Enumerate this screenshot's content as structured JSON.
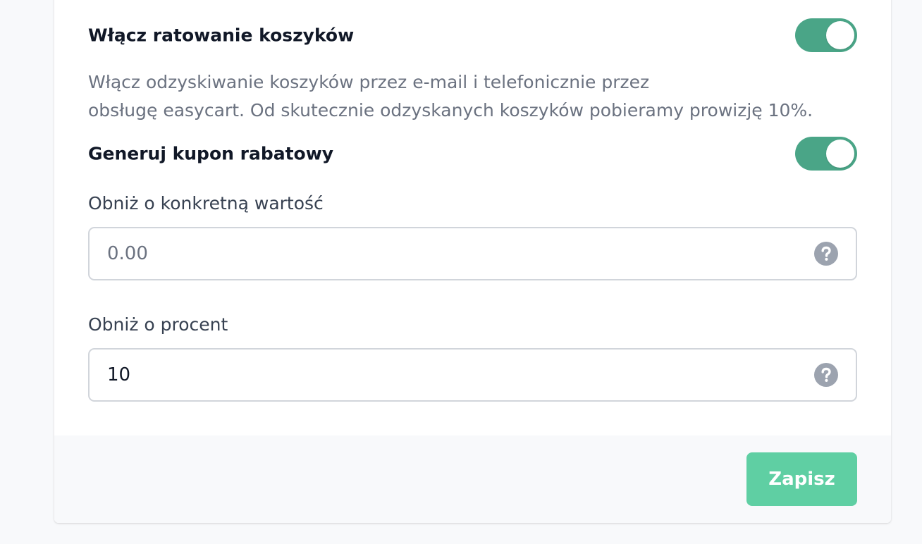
{
  "cart_recovery": {
    "title": "Włącz ratowanie koszyków",
    "enabled": true,
    "description_line1": "Włącz odzyskiwanie koszyków przez e-mail i telefonicznie przez",
    "description_line2": "obsługę easycart. Od skutecznie odzyskanych koszyków pobieramy prowizję 10%."
  },
  "coupon": {
    "title": "Generuj kupon rabatowy",
    "enabled": true
  },
  "fixed_discount": {
    "label": "Obniż o konkretną wartość",
    "value": "",
    "placeholder": "0.00",
    "help_icon": "question-circle-icon"
  },
  "percent_discount": {
    "label": "Obniż o procent",
    "value": "10",
    "placeholder": "",
    "help_icon": "question-circle-icon"
  },
  "footer": {
    "save_label": "Zapisz"
  },
  "colors": {
    "toggle_on": "#4aa587",
    "save_button": "#5fcfa3",
    "help_icon": "#9ca3af"
  }
}
